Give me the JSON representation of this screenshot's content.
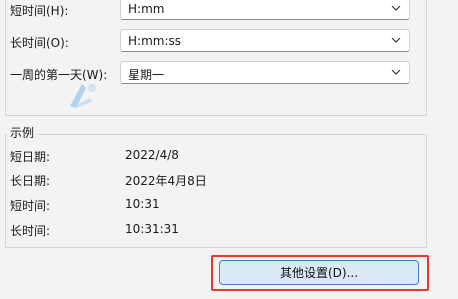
{
  "format_settings": {
    "short_time": {
      "label": "短时间(H):",
      "value": "H:mm"
    },
    "long_time": {
      "label": "长时间(O):",
      "value": "H:mm:ss"
    },
    "first_day_of_week": {
      "label": "一周的第一天(W):",
      "value": "星期一"
    }
  },
  "examples": {
    "legend": "示例",
    "short_date": {
      "label": "短日期:",
      "value": "2022/4/8"
    },
    "long_date": {
      "label": "长日期:",
      "value": "2022年4月8日"
    },
    "short_time": {
      "label": "短时间:",
      "value": "10:31"
    },
    "long_time": {
      "label": "长时间:",
      "value": "10:31:31"
    }
  },
  "buttons": {
    "other_settings": "其他设置(D)..."
  },
  "colors": {
    "highlight": "#e53935",
    "button_border": "#3f7fc6",
    "button_fill": "#dbe9f7"
  }
}
